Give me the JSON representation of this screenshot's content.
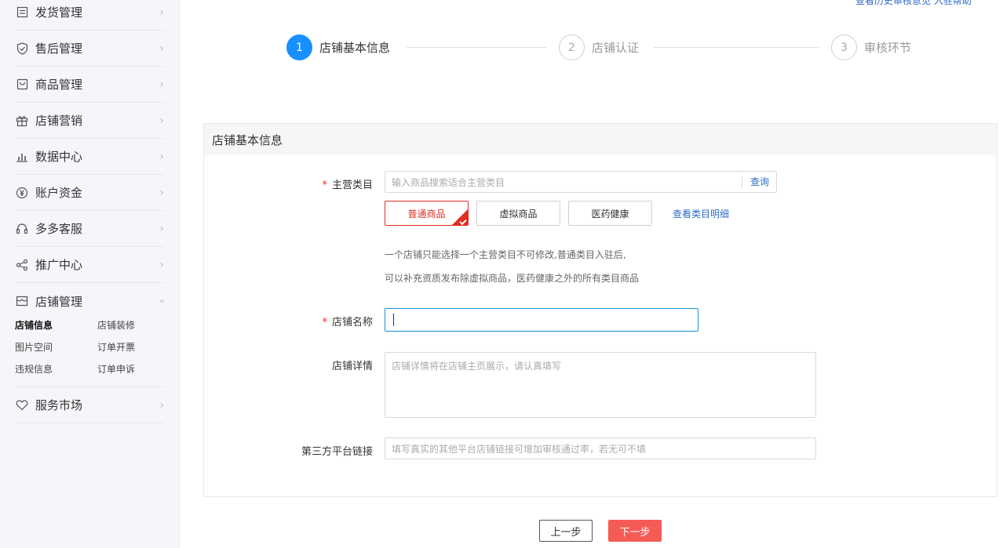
{
  "top_link": "查看历史审核意见    入驻帮助",
  "sidebar": {
    "items": [
      {
        "label": "发货管理",
        "icon": "doc-list-icon"
      },
      {
        "label": "售后管理",
        "icon": "shield-icon"
      },
      {
        "label": "商品管理",
        "icon": "bag-icon"
      },
      {
        "label": "店铺营销",
        "icon": "gift-icon"
      },
      {
        "label": "数据中心",
        "icon": "bar-chart-icon"
      },
      {
        "label": "账户资金",
        "icon": "yuan-icon"
      },
      {
        "label": "多多客服",
        "icon": "headset-icon"
      },
      {
        "label": "推广中心",
        "icon": "share-icon"
      },
      {
        "label": "店铺管理",
        "icon": "store-icon"
      }
    ],
    "store_sub": [
      "店铺信息",
      "店铺装修",
      "图片空间",
      "订单开票",
      "违规信息",
      "订单申诉"
    ],
    "service_market": "服务市场"
  },
  "steps": [
    {
      "num": "1",
      "label": "店铺基本信息"
    },
    {
      "num": "2",
      "label": "店铺认证"
    },
    {
      "num": "3",
      "label": "审核环节"
    }
  ],
  "panel": {
    "title": "店铺基本信息",
    "category": {
      "label": "主营类目",
      "placeholder": "输入商品搜索适合主营类目",
      "search": "查询",
      "types": [
        "普通商品",
        "虚拟商品",
        "医药健康"
      ],
      "detail_link": "查看类目明细",
      "hint1": "一个店铺只能选择一个主营类目不可修改,普通类目入驻后,",
      "hint2": "可以补充资质发布除虚拟商品，医药健康之外的所有类目商品"
    },
    "store_name": {
      "label": "店铺名称",
      "value": ""
    },
    "store_detail": {
      "label": "店铺详情",
      "placeholder": "店铺详情将在店铺主页展示，请认真填写"
    },
    "third_party": {
      "label": "第三方平台链接",
      "placeholder": "填写真实的其他平台店铺链接可增加审核通过率，若无可不填"
    }
  },
  "buttons": {
    "prev": "上一步",
    "next": "下一步"
  },
  "colors": {
    "accent": "#1890ff",
    "danger": "#e02e24",
    "next_button": "#f55b55",
    "link": "#2d6cc4"
  }
}
